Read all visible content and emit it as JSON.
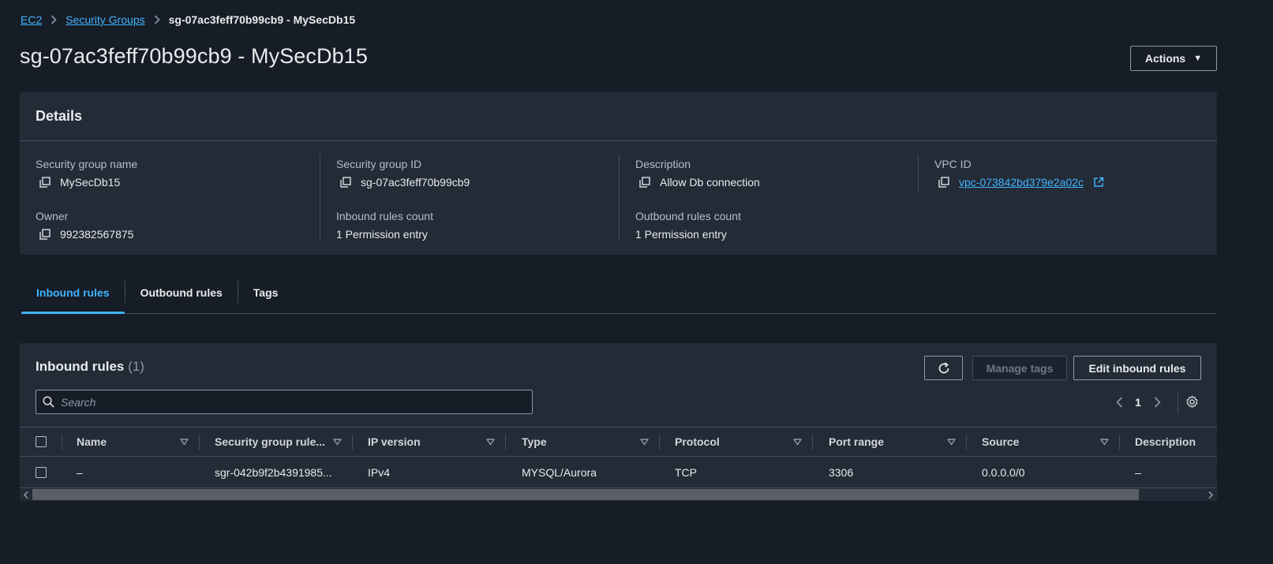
{
  "breadcrumb": {
    "items": [
      "EC2",
      "Security Groups"
    ],
    "current": "sg-07ac3feff70b99cb9 - MySecDb15"
  },
  "page": {
    "title": "sg-07ac3feff70b99cb9 - MySecDb15",
    "actions_label": "Actions"
  },
  "details": {
    "heading": "Details",
    "sg_name_label": "Security group name",
    "sg_name_value": "MySecDb15",
    "sg_id_label": "Security group ID",
    "sg_id_value": "sg-07ac3feff70b99cb9",
    "description_label": "Description",
    "description_value": "Allow Db connection",
    "vpc_label": "VPC ID",
    "vpc_value": "vpc-073842bd379e2a02c",
    "owner_label": "Owner",
    "owner_value": "992382567875",
    "inbound_count_label": "Inbound rules count",
    "inbound_count_value": "1 Permission entry",
    "outbound_count_label": "Outbound rules count",
    "outbound_count_value": "1 Permission entry"
  },
  "tabs": [
    {
      "label": "Inbound rules",
      "active": true
    },
    {
      "label": "Outbound rules",
      "active": false
    },
    {
      "label": "Tags",
      "active": false
    }
  ],
  "rules": {
    "title": "Inbound rules",
    "count": "(1)",
    "manage_tags_label": "Manage tags",
    "edit_label": "Edit inbound rules",
    "search_placeholder": "Search",
    "page_number": "1",
    "columns": [
      "Name",
      "Security group rule...",
      "IP version",
      "Type",
      "Protocol",
      "Port range",
      "Source",
      "Description"
    ],
    "rows": [
      [
        "–",
        "sgr-042b9f2b4391985...",
        "IPv4",
        "MYSQL/Aurora",
        "TCP",
        "3306",
        "0.0.0.0/0",
        "–"
      ]
    ]
  },
  "colors": {
    "background": "#161d26",
    "panel": "#232b37",
    "link": "#42b4ff",
    "border": "#414d5c"
  }
}
